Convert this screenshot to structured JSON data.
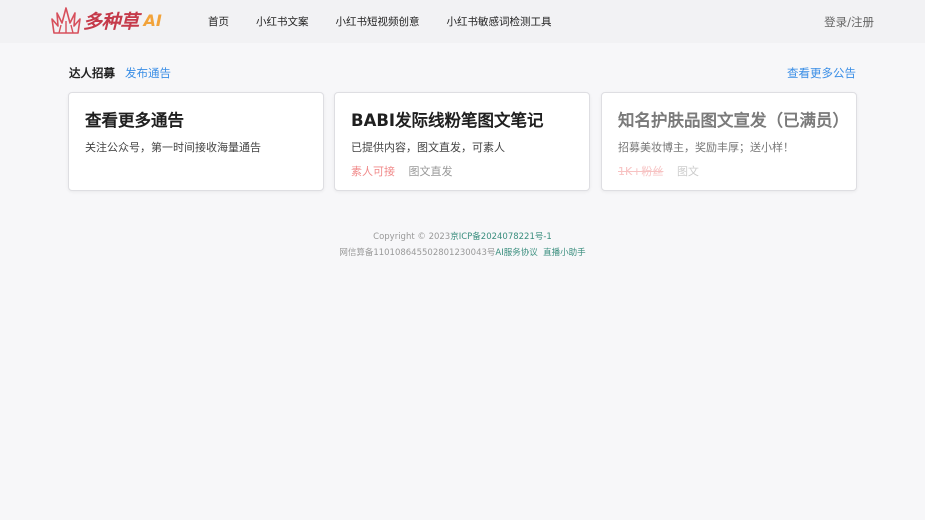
{
  "brand": {
    "name": "多种草",
    "suffix": "AI"
  },
  "nav": [
    {
      "label": "首页"
    },
    {
      "label": "小红书文案"
    },
    {
      "label": "小红书短视频创意"
    },
    {
      "label": "小红书敏感词检测工具"
    }
  ],
  "login": "登录/注册",
  "section": {
    "title": "达人招募",
    "publish": "发布通告",
    "more": "查看更多公告"
  },
  "cards": [
    {
      "title": "查看更多通告",
      "desc": "关注公众号，第一时间接收海量通告",
      "tag1": "",
      "tag2": ""
    },
    {
      "title": "BABI发际线粉笔图文笔记",
      "desc": "已提供内容，图文直发，可素人",
      "tag1": "素人可接",
      "tag2": "图文直发"
    },
    {
      "title": "知名护肤品图文宣发（已满员）",
      "desc": "招募美妆博主，奖励丰厚；送小样！",
      "tag1": "1K+粉丝",
      "tag2": "图文"
    }
  ],
  "footer": {
    "copyright": "Copyright © 2023",
    "icp": "京ICP备2024078221号-1",
    "algo": "网信算备110108645502801230043号",
    "ai_agreement": "AI服务协议",
    "live_helper": "直播小助手"
  },
  "colors": {
    "accent": "#3a8ee6",
    "brand_red": "#c53a4a",
    "brand_orange": "#f2a33a"
  }
}
